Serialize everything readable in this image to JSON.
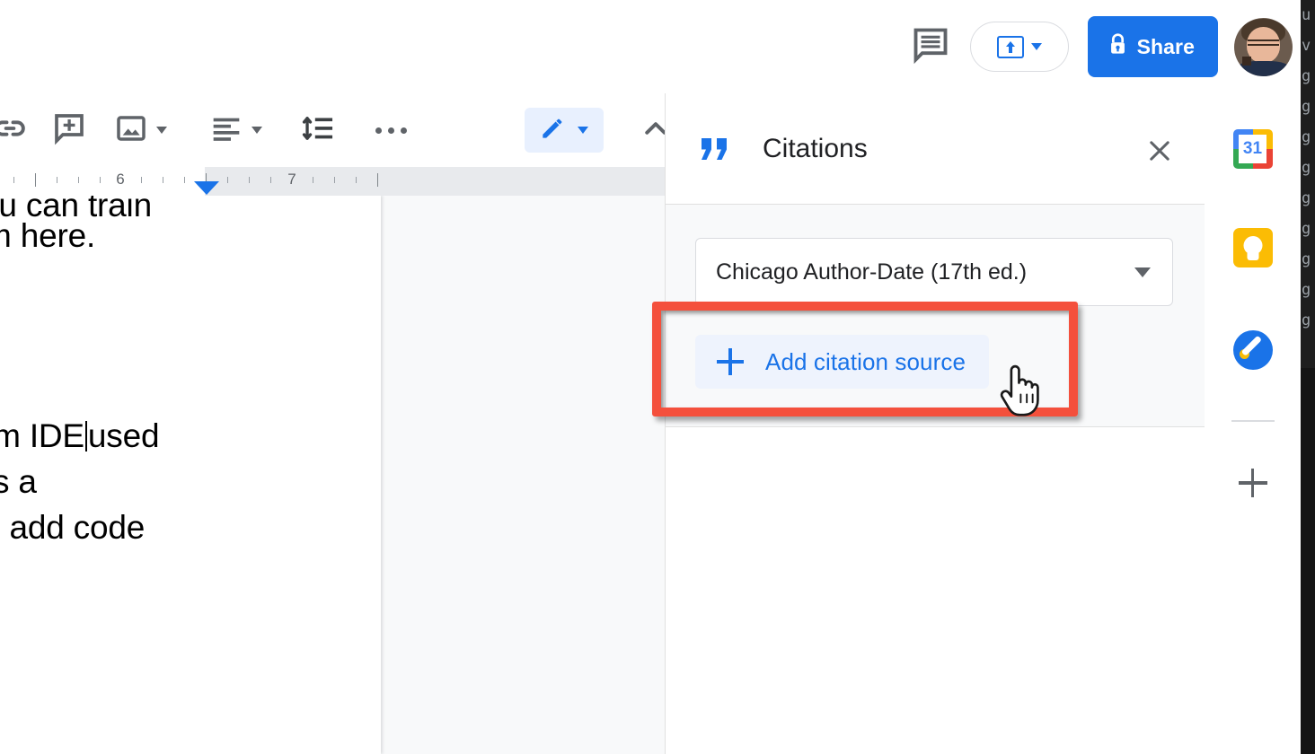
{
  "app": {
    "name": "Google Docs"
  },
  "topbar": {
    "comment_icon": "comment-icon",
    "present_icon": "present-upload-icon",
    "present_caret_icon": "chevron-down-icon",
    "share": {
      "label": "Share",
      "icon": "lock-icon",
      "color": "#1a73e8"
    },
    "avatar": {
      "name": "user-avatar"
    }
  },
  "toolbar": {
    "items": [
      {
        "name": "insert-link",
        "icon": "link-icon"
      },
      {
        "name": "add-comment",
        "icon": "add-comment-icon"
      },
      {
        "name": "insert-image",
        "icon": "image-icon",
        "caret": "chevron-down-icon"
      },
      {
        "name": "text-align",
        "icon": "align-left-icon",
        "caret": "chevron-down-icon"
      },
      {
        "name": "line-spacing",
        "icon": "line-spacing-icon"
      },
      {
        "name": "more-options",
        "icon": "more-horizontal-icon"
      }
    ],
    "mode": {
      "name": "editing-mode",
      "icon": "pencil-icon",
      "caret": "chevron-down-icon"
    },
    "collapse": {
      "name": "collapse-toolbar",
      "icon": "chevron-up-icon"
    }
  },
  "ruler": {
    "numbers": [
      "6",
      "7"
    ],
    "indent_marker": "right-indent-marker"
  },
  "document": {
    "lines": [
      {
        "text": "ou can train",
        "clipped": true
      },
      {
        "text": "m here.",
        "clipped": true
      },
      {
        "pre": "rm IDE",
        "post": "used",
        "caret": true
      },
      {
        "text": "is a",
        "clipped": true
      },
      {
        "text": "o add code",
        "clipped": true
      }
    ]
  },
  "citations_panel": {
    "title": "Citations",
    "quote_icon": "quote-icon",
    "close_icon": "close-icon",
    "style_select": {
      "value": "Chicago Author-Date (17th ed.)",
      "caret_icon": "chevron-down-icon"
    },
    "add_source": {
      "label": "Add citation source",
      "icon": "plus-icon",
      "color": "#1a73e8"
    }
  },
  "annotation": {
    "name": "highlight-rectangle",
    "color": "#f4503c",
    "target": "Add citation source"
  },
  "cursor": {
    "type": "pointing-hand"
  },
  "side_panel": {
    "apps": [
      {
        "name": "google-calendar",
        "label": "31"
      },
      {
        "name": "google-keep",
        "label": ""
      },
      {
        "name": "google-tasks",
        "label": ""
      }
    ],
    "add_label": "",
    "add_icon": "plus-icon"
  },
  "background_window": {
    "glyphs": [
      "u",
      "",
      "v",
      "g",
      "g",
      "g",
      "g",
      "g",
      "g",
      "g",
      "g",
      "g"
    ]
  }
}
